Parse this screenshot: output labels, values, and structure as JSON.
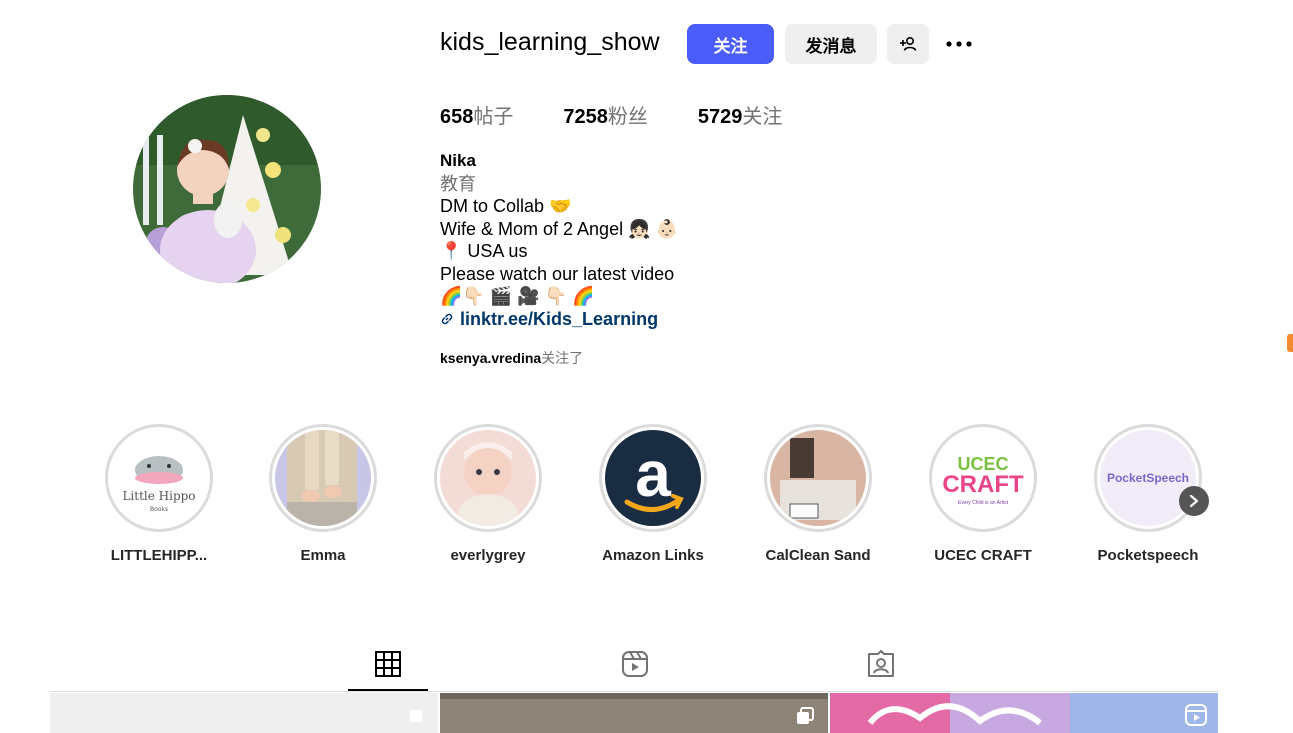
{
  "profile": {
    "username": "kids_learning_show",
    "follow_label": "关注",
    "message_label": "发消息",
    "stats": {
      "posts_count": "658",
      "posts_label": "帖子",
      "followers_count": "7258",
      "followers_label": "粉丝",
      "following_count": "5729",
      "following_label": "关注"
    },
    "bio": {
      "name": "Nika",
      "category": "教育",
      "line1": "DM to Collab 🤝",
      "line2": "Wife & Mom of 2 Angel 👧🏻 👶🏻",
      "line3": "📍 USA us",
      "line4": "Please watch our latest video",
      "line5": "🌈👇🏻 🎬 🎥 👇🏻 🌈",
      "link": "linktr.ee/Kids_Learning"
    },
    "followed_by_user": "ksenya.vredina",
    "followed_by_suffix": "关注了"
  },
  "highlights": [
    {
      "label": "LITTLEHIPP...",
      "logo_text": "Little Hippo",
      "logo_sub": "Books"
    },
    {
      "label": "Emma"
    },
    {
      "label": "everlygrey"
    },
    {
      "label": "Amazon Links",
      "logo_text": "a"
    },
    {
      "label": "CalClean Sand"
    },
    {
      "label": "UCEC CRAFT",
      "logo_text": "UCEC",
      "logo_text2": "CRAFT",
      "logo_sub": "Every Child is an Artist"
    },
    {
      "label": "Pocketspeech",
      "logo_text": "PocketSpeech"
    }
  ],
  "colors": {
    "accent": "#4a5df9",
    "link": "#00376b",
    "secondary_text": "#737373",
    "button_bg": "#efefef"
  },
  "icons": {
    "add_user": "add-user-icon",
    "more": "more-icon",
    "grid_tab": "grid-icon",
    "reels_tab": "reels-icon",
    "tagged_tab": "tagged-icon",
    "next": "chevron-right-icon",
    "link": "link-icon"
  }
}
